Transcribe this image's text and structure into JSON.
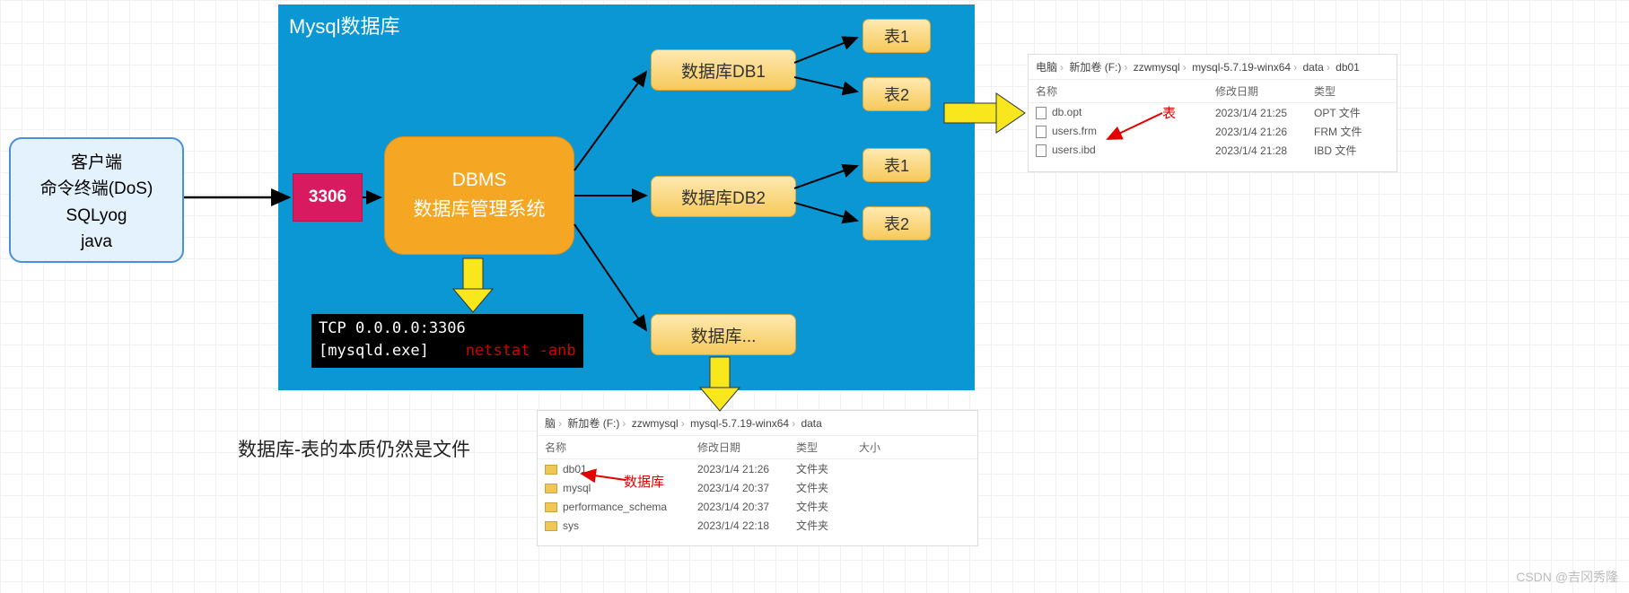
{
  "client": {
    "line1": "客户端",
    "line2": "命令终端(DoS)",
    "line3": "SQLyog",
    "line4": "java"
  },
  "mysql_title": "Mysql数据库",
  "port_label": "3306",
  "dbms": {
    "line1": "DBMS",
    "line2": "数据库管理系统"
  },
  "databases": {
    "db1": "数据库DB1",
    "db2": "数据库DB2",
    "db3": "数据库..."
  },
  "tables": {
    "t1": "表1",
    "t2": "表2"
  },
  "terminal": {
    "line1": " TCP    0.0.0.0:3306",
    "line2_a": "[mysqld.exe]",
    "line2_b": "netstat -anb"
  },
  "essence_text": "数据库-表的本质仍然是文件",
  "fe1": {
    "crumbs": [
      "电脑",
      "新加卷 (F:)",
      "zzwmysql",
      "mysql-5.7.19-winx64",
      "data",
      "db01"
    ],
    "head": {
      "name": "名称",
      "date": "修改日期",
      "type": "类型"
    },
    "rows": [
      {
        "name": "db.opt",
        "date": "2023/1/4 21:25",
        "type": "OPT 文件"
      },
      {
        "name": "users.frm",
        "date": "2023/1/4 21:26",
        "type": "FRM 文件"
      },
      {
        "name": "users.ibd",
        "date": "2023/1/4 21:28",
        "type": "IBD 文件"
      }
    ],
    "anno": "表"
  },
  "fe2": {
    "crumbs": [
      "脑",
      "新加卷 (F:)",
      "zzwmysql",
      "mysql-5.7.19-winx64",
      "data"
    ],
    "head": {
      "name": "名称",
      "date": "修改日期",
      "type": "类型",
      "size": "大小"
    },
    "rows": [
      {
        "name": "db01",
        "date": "2023/1/4 21:26",
        "type": "文件夹"
      },
      {
        "name": "mysql",
        "date": "2023/1/4 20:37",
        "type": "文件夹"
      },
      {
        "name": "performance_schema",
        "date": "2023/1/4 20:37",
        "type": "文件夹"
      },
      {
        "name": "sys",
        "date": "2023/1/4 22:18",
        "type": "文件夹"
      }
    ],
    "anno": "数据库"
  },
  "watermark": "CSDN @吉冈秀隆"
}
